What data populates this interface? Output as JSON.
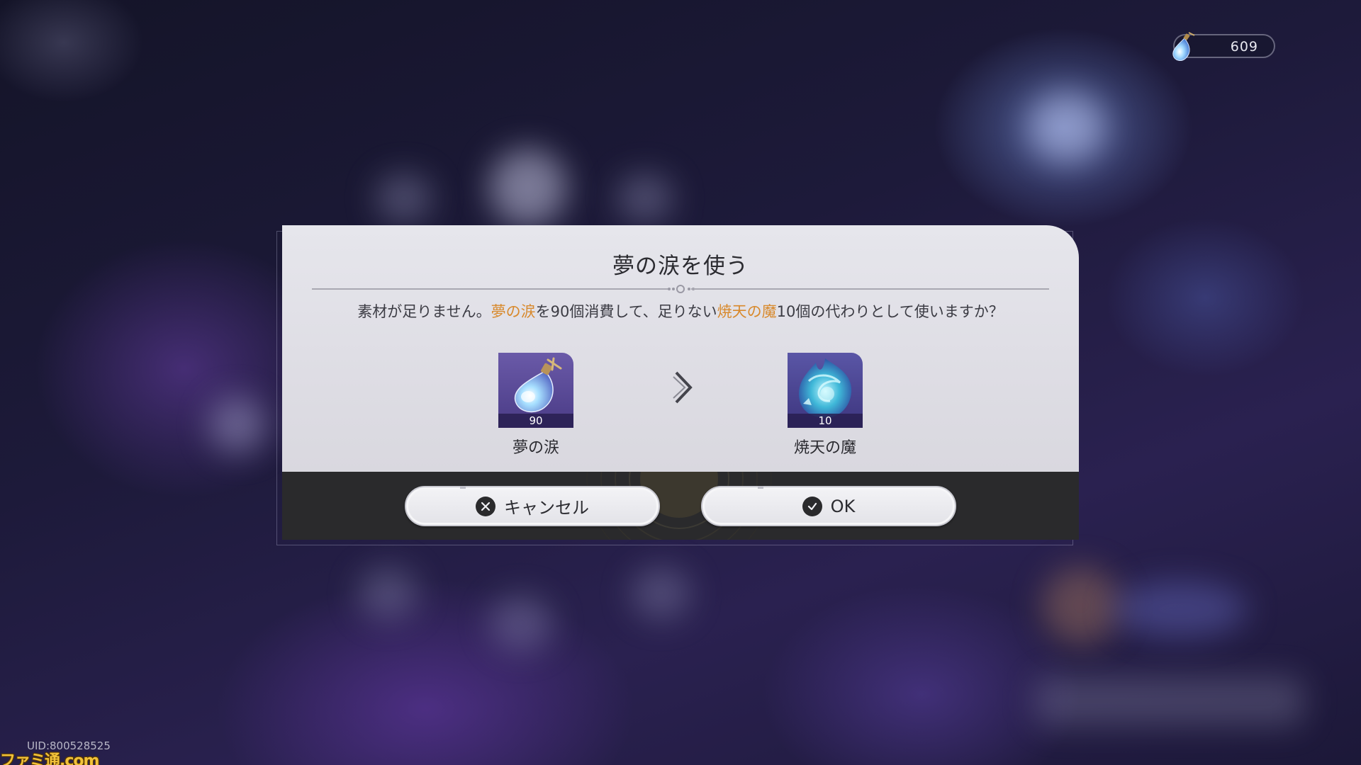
{
  "currency": {
    "icon": "dream-tear-icon",
    "value": "609"
  },
  "dialog": {
    "title": "夢の涙を使う",
    "message": {
      "part1": "素材が足りません。",
      "highlight1": "夢の涙",
      "part2": "を90個消費して、足りない",
      "highlight2": "焼天の魔",
      "part3": "10個の代わりとして使いますか？",
      "highlight_color": "#d8892c"
    },
    "from_item": {
      "name": "夢の涙",
      "count": "90",
      "icon": "dream-tear-icon"
    },
    "arrow_icon": "chevron-right-icon",
    "to_item": {
      "name": "焼天の魔",
      "count": "10",
      "icon": "blue-flame-icon"
    },
    "buttons": {
      "cancel_label": "キャンセル",
      "cancel_icon": "cross-icon",
      "ok_label": "OK",
      "ok_icon": "check-icon"
    }
  },
  "footer": {
    "uid": "UID:800528525",
    "watermark": "ファミ通.com"
  }
}
